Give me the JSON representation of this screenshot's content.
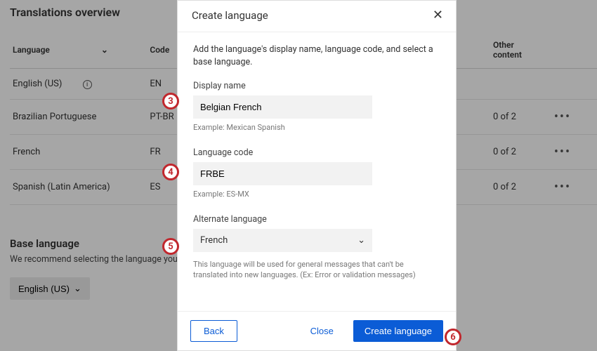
{
  "page": {
    "title": "Translations overview",
    "columns": {
      "language": "Language",
      "code": "Code",
      "other": "Other content"
    },
    "rows": [
      {
        "name": "English (US)",
        "code": "EN",
        "other": "",
        "isBase": true
      },
      {
        "name": "Brazilian Portuguese",
        "code": "PT-BR",
        "other": "0 of 2",
        "isBase": false
      },
      {
        "name": "French",
        "code": "FR",
        "other": "0 of 2",
        "isBase": false
      },
      {
        "name": "Spanish (Latin America)",
        "code": "ES",
        "other": "0 of 2",
        "isBase": false
      }
    ],
    "baseSection": {
      "title": "Base language",
      "desc": "We recommend selecting the language your …  displayed in this language.",
      "selected": "English (US)"
    }
  },
  "modal": {
    "title": "Create language",
    "intro": "Add the language's display name, language code, and select a base language.",
    "displayName": {
      "label": "Display name",
      "value": "Belgian French",
      "hint": "Example: Mexican Spanish"
    },
    "languageCode": {
      "label": "Language code",
      "value": "FRBE",
      "hint": "Example: ES-MX"
    },
    "altLanguage": {
      "label": "Alternate language",
      "value": "French",
      "hint": "This language will be used for general messages that can't be translated into new languages. (Ex: Error or validation messages)"
    },
    "buttons": {
      "back": "Back",
      "close": "Close",
      "create": "Create language"
    }
  },
  "callouts": {
    "c3": "3",
    "c4": "4",
    "c5": "5",
    "c6": "6"
  }
}
